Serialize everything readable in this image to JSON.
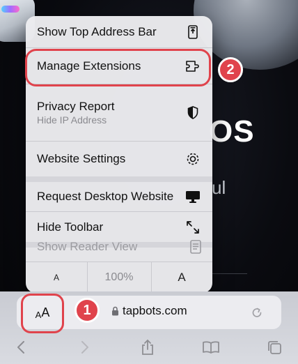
{
  "menu": {
    "items": [
      {
        "label": "Show Top Address Bar",
        "icon": "show-top-address-bar-icon"
      },
      {
        "label": "Manage Extensions",
        "icon": "puzzle-extension-icon"
      },
      {
        "label": "Privacy Report",
        "sublabel": "Hide IP Address",
        "icon": "shield-icon"
      },
      {
        "label": "Website Settings",
        "icon": "gear-icon"
      },
      {
        "label": "Request Desktop Website",
        "icon": "desktop-monitor-icon"
      },
      {
        "label": "Hide Toolbar",
        "icon": "arrows-diagonal-icon"
      },
      {
        "label": "Show Reader View",
        "icon": "reader-view-icon",
        "disabled": true
      }
    ],
    "text_size": {
      "decrease_label": "A",
      "zoom": "100%",
      "increase_label": "A"
    }
  },
  "address_bar": {
    "aa_small": "A",
    "aa_big": "A",
    "url": "tapbots.com"
  },
  "annotations": {
    "step1": "1",
    "step2": "2",
    "color": "#e0434c"
  },
  "background": {
    "headline": "OS",
    "subtext": "ul"
  }
}
